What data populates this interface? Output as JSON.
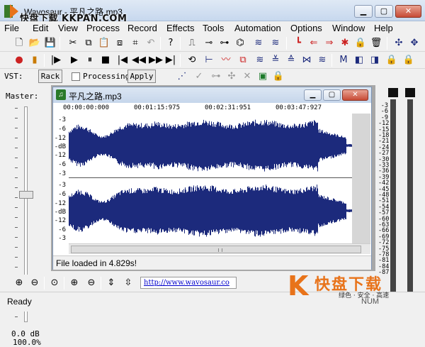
{
  "window": {
    "title": "Wavosaur - 平凡之路.mp3",
    "watermark": "快盘下载 KKPAN.COM"
  },
  "menu": [
    "File",
    "Edit",
    "View",
    "Process",
    "Record",
    "Effects",
    "Tools",
    "Automation",
    "Options",
    "Window",
    "Help"
  ],
  "vst": {
    "label": "VST:",
    "rack_label": "Rack",
    "processing_label": "Processing",
    "apply_label": "Apply",
    "processing_checked": false
  },
  "master": {
    "label": "Master:",
    "db": "0.0 dB",
    "percent": "100.0%"
  },
  "document": {
    "title": "平凡之路.mp3",
    "ruler": [
      "00:00:00:000",
      "00:01:15:975",
      "00:02:31:951",
      "00:03:47:927"
    ],
    "axis_top": [
      "-3",
      "-6",
      "-12",
      "-dB",
      "-12",
      "-6",
      "-3"
    ],
    "axis_bottom": [
      "-3",
      "-6",
      "-12",
      "-dB",
      "-12",
      "-6",
      "-3"
    ],
    "status": "File loaded in 4.829s!"
  },
  "vu_labels": [
    "-3",
    "-6",
    "-9",
    "-12",
    "-15",
    "-18",
    "-21",
    "-24",
    "-27",
    "-30",
    "-33",
    "-36",
    "-39",
    "-42",
    "-45",
    "-48",
    "-51",
    "-54",
    "-57",
    "-60",
    "-63",
    "-66",
    "-69",
    "-72",
    "-75",
    "-78",
    "-81",
    "-84",
    "-87"
  ],
  "bottom": {
    "url": "http://www.wavosaur.co"
  },
  "statusbar": {
    "ready": "Ready",
    "num": "NUM"
  },
  "watermark_logo": {
    "big": "快盘下载",
    "sub": "绿色 · 安全 · 高速"
  },
  "colors": {
    "waveform": "#1c2a7c",
    "accent_red": "#cc2222"
  }
}
